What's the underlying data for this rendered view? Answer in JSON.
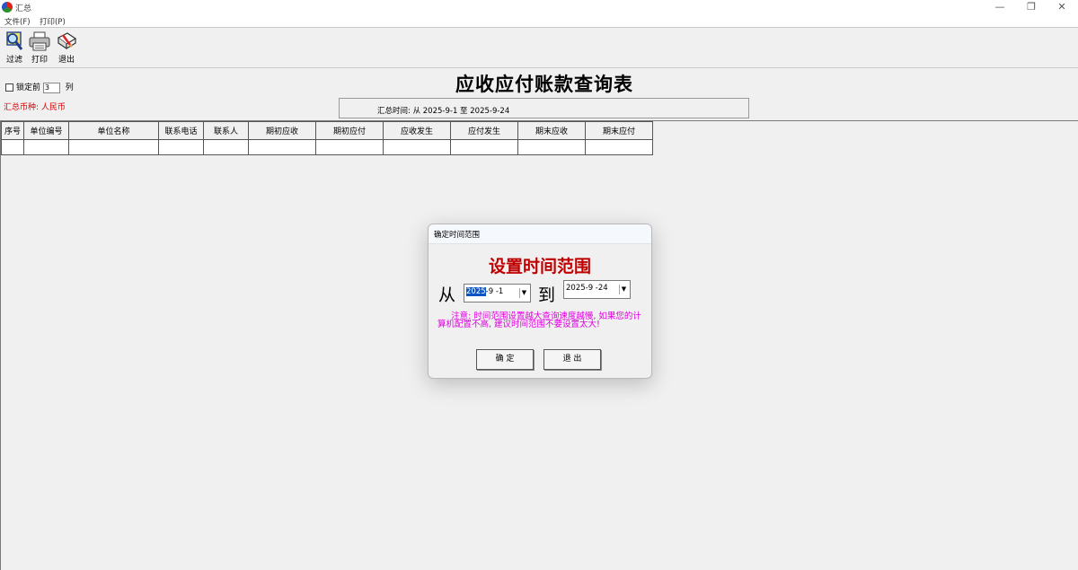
{
  "window": {
    "title": "汇总"
  },
  "menu": {
    "file": "文件(F)",
    "print": "打印(P)"
  },
  "toolbar": {
    "filter_label": "过滤",
    "print_label": "打印",
    "exit_label": "退出"
  },
  "report": {
    "title": "应收应付账款查询表",
    "lock_prefix": "锁定前",
    "lock_value": "3",
    "lock_suffix": "列",
    "currency": "汇总币种: 人民币",
    "period": "汇总时间: 从 2025-9-1 至 2025-9-24"
  },
  "grid": {
    "columns": [
      "序号",
      "单位编号",
      "单位名称",
      "联系电话",
      "联系人",
      "期初应收",
      "期初应付",
      "应收发生",
      "应付发生",
      "期末应收",
      "期末应付"
    ]
  },
  "dialog": {
    "title": "确定时间范围",
    "heading": "设置时间范围",
    "from_label": "从",
    "to_label": "到",
    "from_year": "2025",
    "from_rest": "-9 -1",
    "to_date": "2025-9 -24",
    "note": "注意: 时间范围设置越大查询速度越慢, 如果您的计算机配置不高, 建议时间范围不要设置太大!",
    "ok_label": "确 定",
    "exit_label": "退 出"
  }
}
